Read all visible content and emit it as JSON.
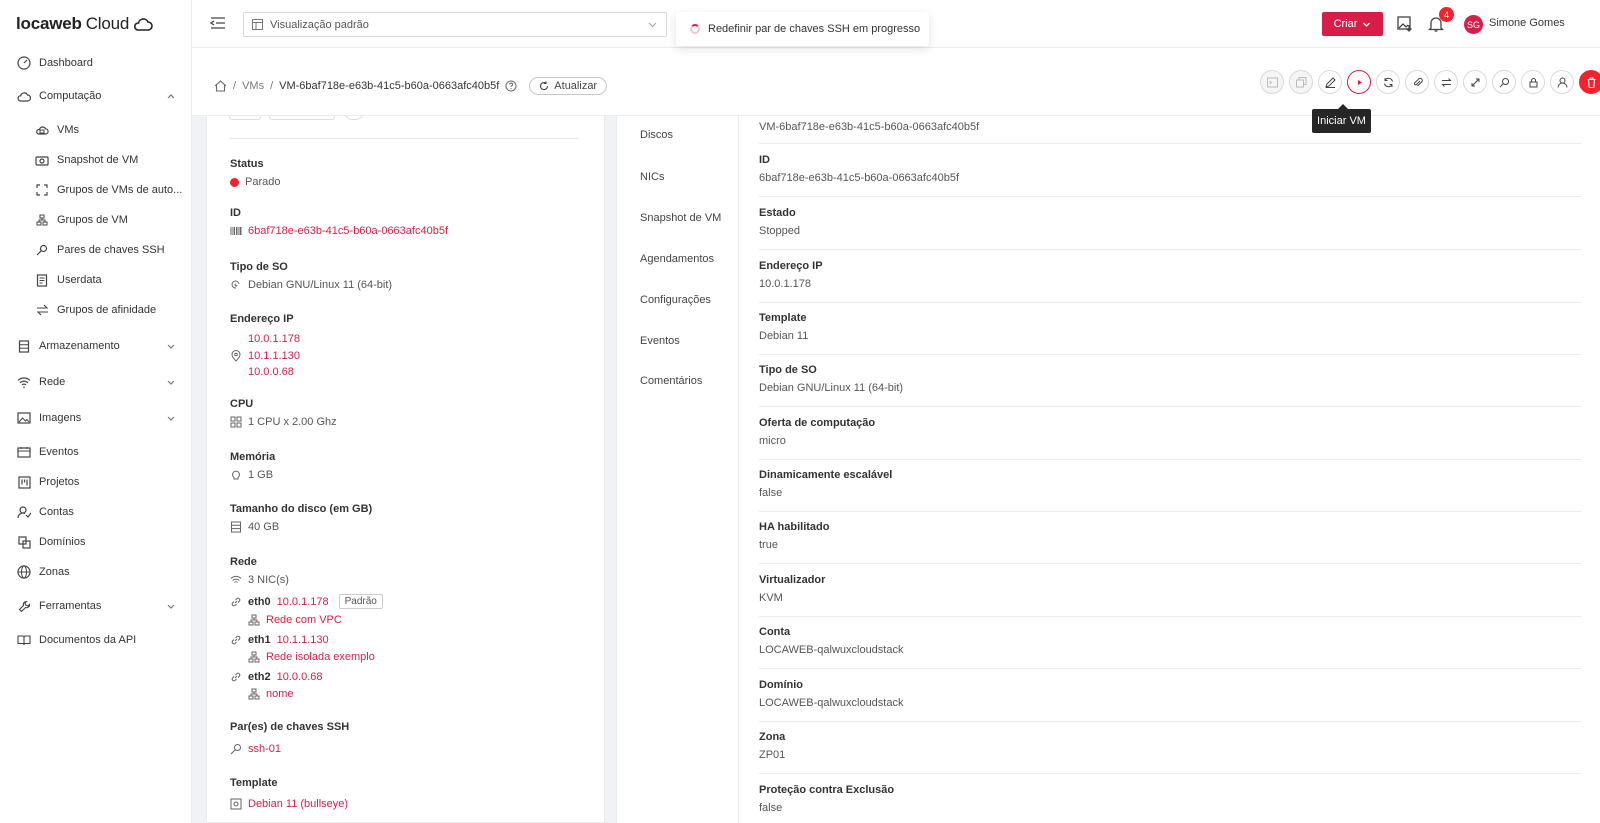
{
  "brand": {
    "name": "locaweb",
    "suffix": "Cloud"
  },
  "sidebar": {
    "items": [
      {
        "label": "Dashboard",
        "icon": "dashboard-icon"
      },
      {
        "label": "Computação",
        "icon": "cloud-icon",
        "expanded": true
      },
      {
        "label": "VMs",
        "icon": "vm-icon",
        "sub": true
      },
      {
        "label": "Snapshot de VM",
        "icon": "camera-icon",
        "sub": true
      },
      {
        "label": "Grupos de VMs de auto...",
        "icon": "autoscale-icon",
        "sub": true
      },
      {
        "label": "Grupos de VM",
        "icon": "cluster-icon",
        "sub": true
      },
      {
        "label": "Pares de chaves SSH",
        "icon": "key-icon",
        "sub": true
      },
      {
        "label": "Userdata",
        "icon": "file-icon",
        "sub": true
      },
      {
        "label": "Grupos de afinidade",
        "icon": "swap-icon",
        "sub": true
      },
      {
        "label": "Armazenamento",
        "icon": "storage-icon"
      },
      {
        "label": "Rede",
        "icon": "wifi-icon"
      },
      {
        "label": "Imagens",
        "icon": "image-icon"
      },
      {
        "label": "Eventos",
        "icon": "calendar-icon"
      },
      {
        "label": "Projetos",
        "icon": "project-icon"
      },
      {
        "label": "Contas",
        "icon": "users-icon"
      },
      {
        "label": "Domínios",
        "icon": "domain-icon"
      },
      {
        "label": "Zonas",
        "icon": "globe-icon"
      },
      {
        "label": "Ferramentas",
        "icon": "tool-icon"
      },
      {
        "label": "Documentos da API",
        "icon": "book-icon"
      }
    ]
  },
  "header": {
    "view_select": "Visualização padrão",
    "create_label": "Criar",
    "notifications_count": "4",
    "avatar_initials": "SG",
    "username": "Simone Gomes"
  },
  "toast": {
    "message": "Redefinir par de chaves SSH em progresso"
  },
  "breadcrumb": {
    "home": "home-icon",
    "vms": "VMs",
    "current": "VM-6baf718e-e63b-41c5-b60a-0663afc40b5f",
    "refresh": "Atualizar"
  },
  "tooltip": {
    "text": "Iniciar VM"
  },
  "details": {
    "status_label": "Status",
    "status_value": "Parado",
    "id_label": "ID",
    "id_value": "6baf718e-e63b-41c5-b60a-0663afc40b5f",
    "os_label": "Tipo de SO",
    "os_value": "Debian GNU/Linux 11 (64-bit)",
    "ip_label": "Endereço IP",
    "ips": [
      "10.0.1.178",
      "10.1.1.130",
      "10.0.0.68"
    ],
    "cpu_label": "CPU",
    "cpu_value": "1 CPU x 2.00 Ghz",
    "mem_label": "Memória",
    "mem_value": "1 GB",
    "disk_label": "Tamanho do disco (em GB)",
    "disk_value": "40 GB",
    "net_label": "Rede",
    "nic_count": "3 NIC(s)",
    "nics": [
      {
        "name": "eth0",
        "ip": "10.0.1.178",
        "tag": "Padrão",
        "network": "Rede com VPC"
      },
      {
        "name": "eth1",
        "ip": "10.1.1.130",
        "network": "Rede isolada exemplo"
      },
      {
        "name": "eth2",
        "ip": "10.0.0.68",
        "network": "nome"
      }
    ],
    "ssh_label": "Par(es) de chaves SSH",
    "ssh_value": "ssh-01",
    "template_label": "Template",
    "template_value": "Debian 11 (bullseye)"
  },
  "tabs": [
    "Discos",
    "NICs",
    "Snapshot de VM",
    "Agendamentos",
    "Configurações",
    "Eventos",
    "Comentários"
  ],
  "props": {
    "name_value": "VM-6baf718e-e63b-41c5-b60a-0663afc40b5f",
    "rows": [
      {
        "k": "ID",
        "v": "6baf718e-e63b-41c5-b60a-0663afc40b5f"
      },
      {
        "k": "Estado",
        "v": "Stopped"
      },
      {
        "k": "Endereço IP",
        "v": "10.0.1.178"
      },
      {
        "k": "Template",
        "v": "Debian 11"
      },
      {
        "k": "Tipo de SO",
        "v": "Debian GNU/Linux 11 (64-bit)"
      },
      {
        "k": "Oferta de computação",
        "v": "micro"
      },
      {
        "k": "Dinamicamente escalável",
        "v": "false"
      },
      {
        "k": "HA habilitado",
        "v": "true"
      },
      {
        "k": "Virtualizador",
        "v": "KVM"
      },
      {
        "k": "Conta",
        "v": "LOCAWEB-qalwuxcloudstack"
      },
      {
        "k": "Domínio",
        "v": "LOCAWEB-qalwuxcloudstack"
      },
      {
        "k": "Zona",
        "v": "ZP01"
      },
      {
        "k": "Proteção contra Exclusão",
        "v": "false"
      }
    ]
  },
  "colors": {
    "accent": "#d81e48",
    "danger": "#f5222d"
  }
}
